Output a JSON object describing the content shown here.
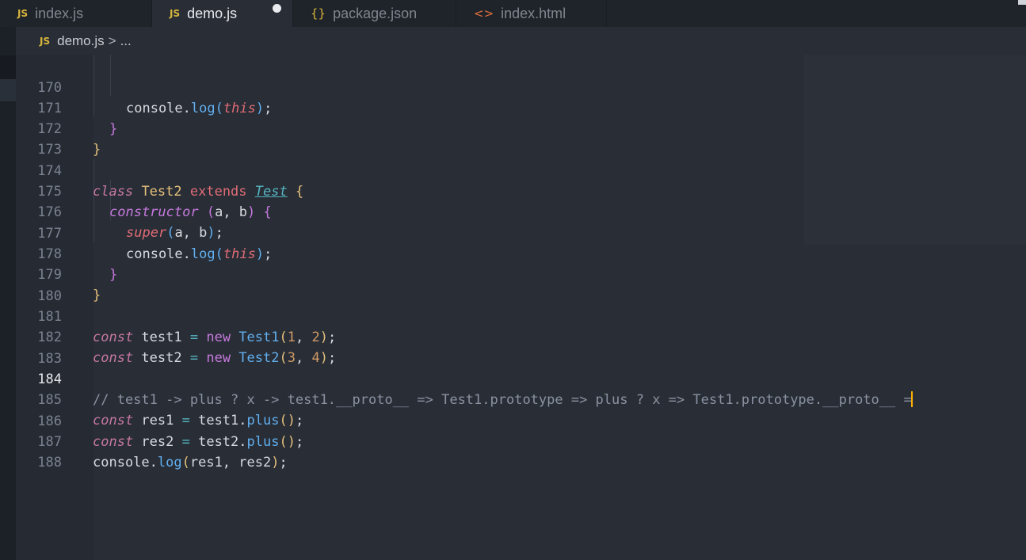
{
  "tabs": [
    {
      "label": "index.js",
      "icon": "js-file-icon",
      "icon_text": "JS",
      "active": false,
      "modified": false
    },
    {
      "label": "demo.js",
      "icon": "js-file-icon",
      "icon_text": "JS",
      "active": true,
      "modified": true
    },
    {
      "label": "package.json",
      "icon": "json-file-icon",
      "icon_text": "{}",
      "active": false,
      "modified": false
    },
    {
      "label": "index.html",
      "icon": "html-file-icon",
      "icon_text": "<>",
      "active": false,
      "modified": false
    }
  ],
  "breadcrumb": {
    "icon_text": "JS",
    "file": "demo.js",
    "separator": ">",
    "rest": "..."
  },
  "editor": {
    "current_line": "184",
    "lines": [
      {
        "n": "170",
        "t": "console.log(this);"
      },
      {
        "n": "171",
        "t": "}"
      },
      {
        "n": "172",
        "t": "}"
      },
      {
        "n": "173",
        "t": ""
      },
      {
        "n": "174",
        "t": "class Test2 extends Test {"
      },
      {
        "n": "175",
        "t": "constructor (a, b) {"
      },
      {
        "n": "176",
        "t": "super(a, b);"
      },
      {
        "n": "177",
        "t": "console.log(this);"
      },
      {
        "n": "178",
        "t": "}"
      },
      {
        "n": "179",
        "t": "}"
      },
      {
        "n": "180",
        "t": ""
      },
      {
        "n": "181",
        "t": "const test1 = new Test1(1, 2);"
      },
      {
        "n": "182",
        "t": "const test2 = new Test2(3, 4);"
      },
      {
        "n": "183",
        "t": ""
      },
      {
        "n": "184",
        "t": "// test1 -> plus ? x -> test1.__proto__ => Test1.prototype => plus ? x => Test1.prototype.__proto__ ="
      },
      {
        "n": "185",
        "t": "const res1 = test1.plus();"
      },
      {
        "n": "186",
        "t": "const res2 = test2.plus();"
      },
      {
        "n": "187",
        "t": "console.log(res1, res2);"
      },
      {
        "n": "188",
        "t": ""
      }
    ]
  },
  "colors": {
    "editor_bg": "#282d36",
    "tab_bg": "#1f232a",
    "cursor": "#ffb000",
    "js_icon": "#d9b53c",
    "keyword": "#c678a0",
    "class": "#e5c07b"
  }
}
